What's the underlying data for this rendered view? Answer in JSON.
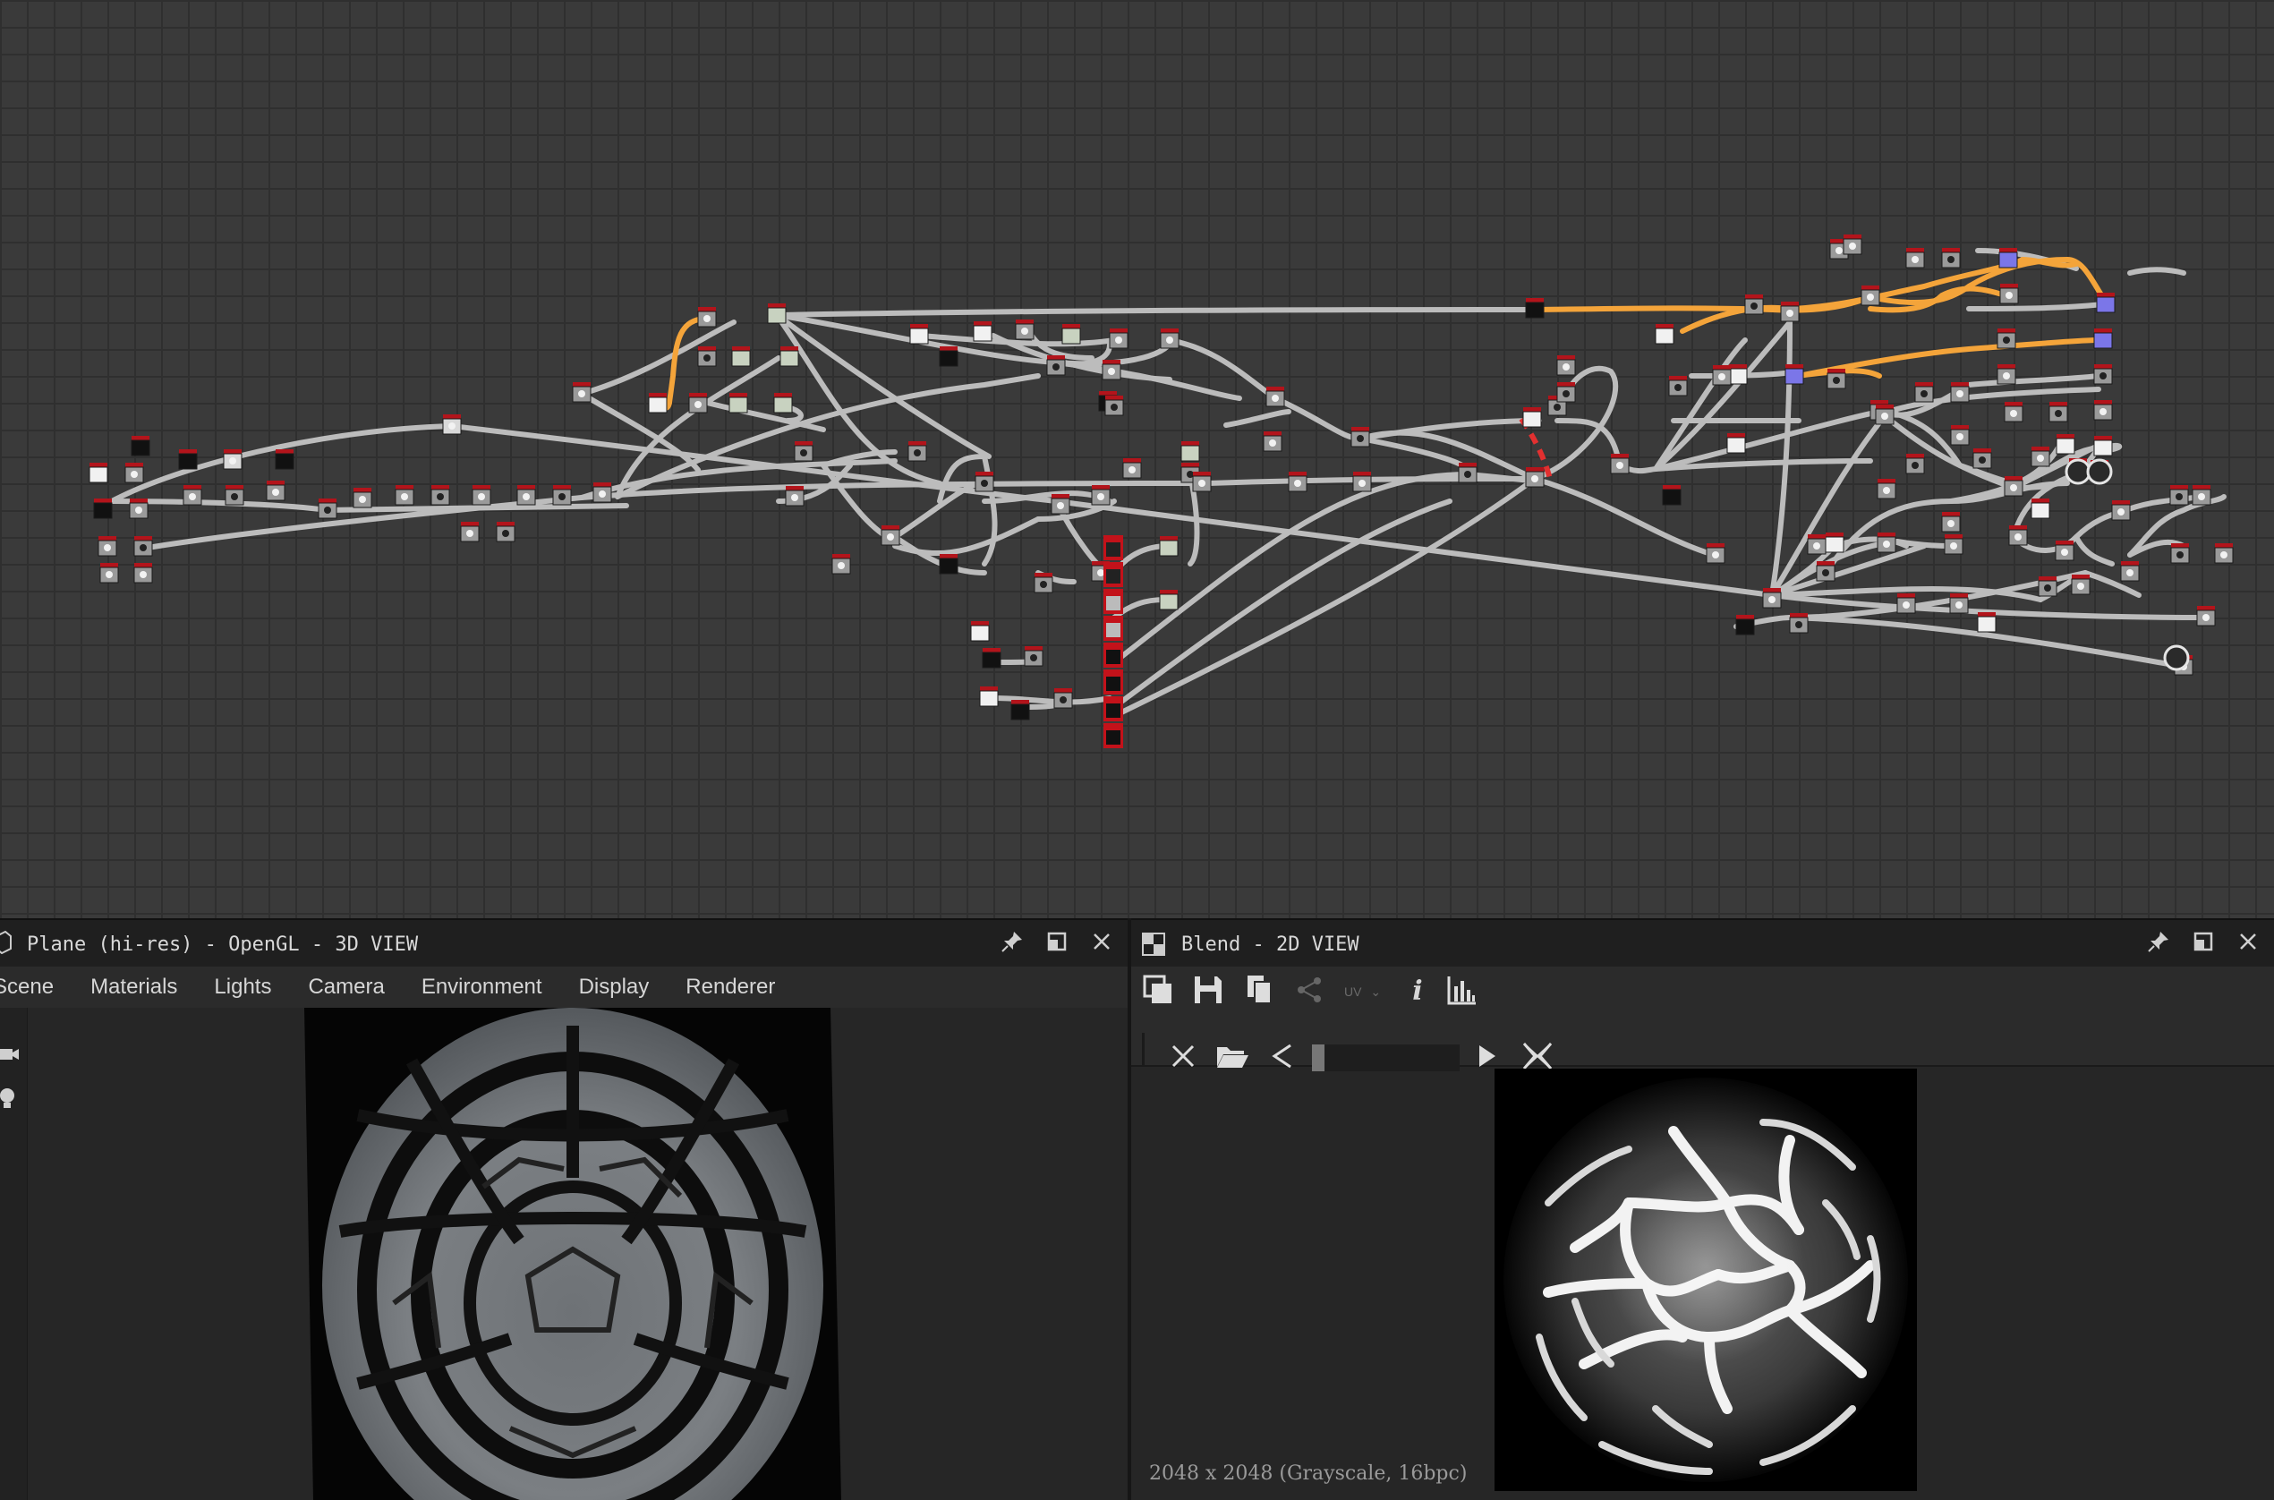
{
  "graph": {
    "links_color": "#b8b8b8",
    "highlight_color": "#f4a43a",
    "selected_link_color": "#e23030"
  },
  "panel_3d": {
    "title": "Plane (hi-res) - OpenGL - 3D VIEW",
    "menu": [
      "Scene",
      "Materials",
      "Lights",
      "Camera",
      "Environment",
      "Display",
      "Renderer"
    ]
  },
  "panel_2d": {
    "title": "Blend - 2D VIEW",
    "uv_label": "UV",
    "status": "2048 x 2048 (Grayscale, 16bpc)"
  },
  "icons": {
    "pin": "pin-icon",
    "maximize": "maximize-icon",
    "close": "close-icon",
    "camera": "camera-icon",
    "light": "light-bulb-icon"
  }
}
